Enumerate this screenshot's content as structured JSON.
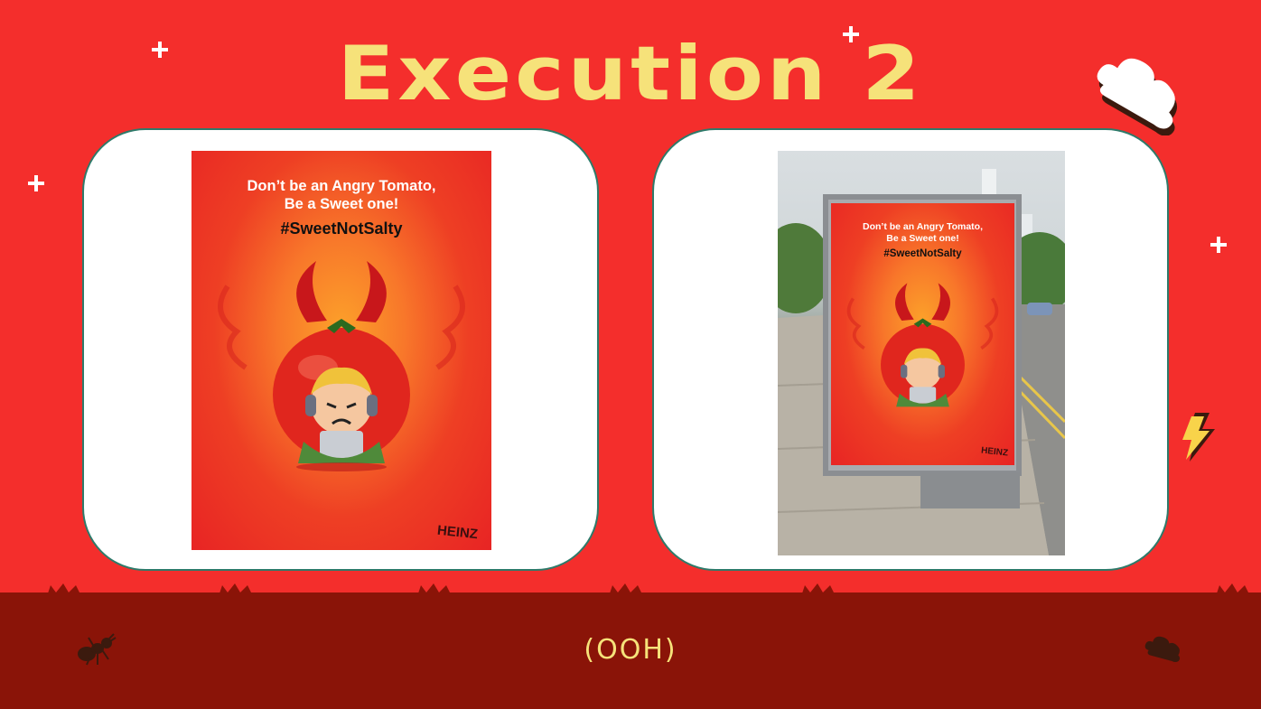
{
  "slide": {
    "title": "Execution 2",
    "footer_label": "(OOH)"
  },
  "poster": {
    "headline_line1": "Don’t be an Angry Tomato,",
    "headline_line2": "Be a Sweet one!",
    "hashtag": "#SweetNotSalty",
    "brand": "HEINZ"
  },
  "billboard": {
    "headline_line1": "Don’t be an Angry Tomato,",
    "headline_line2": "Be a Sweet one!",
    "hashtag": "#SweetNotSalty",
    "brand": "HEINZ"
  },
  "colors": {
    "background": "#f42e2c",
    "title": "#f6e27a",
    "footer": "#8a1408",
    "card_border": "#2e7a6a"
  },
  "decorations": [
    "sparkle-icon",
    "cloud-icon",
    "lightning-icon",
    "ant-icon",
    "cloud-small-icon",
    "grass-tuft-icon"
  ]
}
